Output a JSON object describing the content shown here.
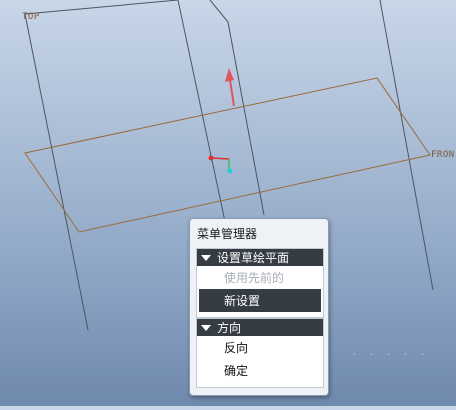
{
  "viewport": {
    "datum_top_label": "TOP",
    "datum_front_label": "FRON"
  },
  "menu_manager": {
    "title": "菜单管理器",
    "groups": [
      {
        "header": "设置草绘平面",
        "items": [
          {
            "label": "使用先前的",
            "state": "disabled"
          },
          {
            "label": "新设置",
            "state": "selected"
          }
        ]
      },
      {
        "header": "方向",
        "items": [
          {
            "label": "反向",
            "state": "normal"
          },
          {
            "label": "确定",
            "state": "normal"
          }
        ]
      }
    ]
  },
  "colors": {
    "datum_plane": "#9a6a3a",
    "datum_edge": "#4d5560",
    "normal_arrow": "#e0555a",
    "csys_x": "#e03030",
    "csys_y": "#3dbb5a",
    "csys_z": "#22d0d8",
    "menu_header_bg": "#353c44"
  }
}
